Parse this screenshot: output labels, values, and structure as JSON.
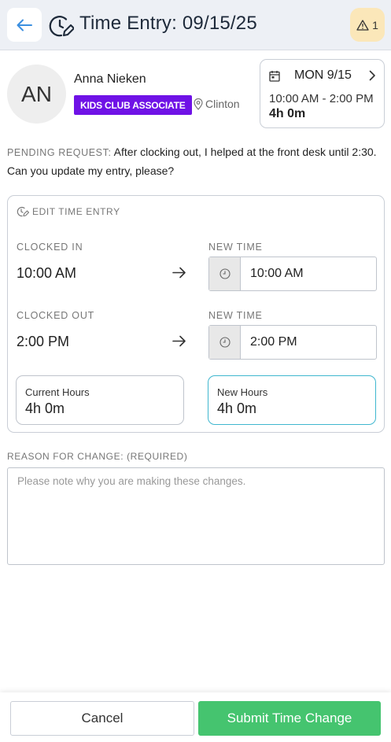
{
  "header": {
    "title": "Time Entry: 09/15/25",
    "alert_count": "1",
    "back_icon": "arrow-left-icon",
    "title_icon": "clock-edit-icon",
    "alert_icon": "warning-triangle-icon"
  },
  "employee": {
    "initials": "AN",
    "name": "Anna Nieken",
    "role": "KIDS CLUB ASSOCIATE",
    "location": "Clinton"
  },
  "shift": {
    "day": "MON 9/15",
    "time_range": "10:00 AM - 2:00 PM",
    "hours": "4h 0m"
  },
  "pending_request": {
    "label": "PENDING REQUEST:",
    "message": "After clocking out, I helped at the front desk until 2:30. Can you update my entry, please?"
  },
  "edit": {
    "heading": "EDIT TIME ENTRY",
    "clocked_in_label": "CLOCKED IN",
    "clocked_in_value": "10:00 AM",
    "new_in_label": "NEW TIME",
    "new_in_value": "10:00 AM",
    "clocked_out_label": "CLOCKED OUT",
    "clocked_out_value": "2:00 PM",
    "new_out_label": "NEW TIME",
    "new_out_value": "2:00 PM",
    "current_hours_label": "Current Hours",
    "current_hours_value": "4h 0m",
    "new_hours_label": "New Hours",
    "new_hours_value": "4h 0m"
  },
  "reason": {
    "label": "REASON FOR CHANGE: (REQUIRED)",
    "placeholder": "Please note why you are making these changes."
  },
  "footer": {
    "cancel_label": "Cancel",
    "submit_label": "Submit Time Change"
  },
  "colors": {
    "header_bg": "#edf0f5",
    "accent_blue": "#3b8fe0",
    "role_badge": "#6f12e6",
    "alert_bg": "#fbe7b9",
    "new_hours_border": "#3fb7cf",
    "submit_green": "#45c46f"
  }
}
